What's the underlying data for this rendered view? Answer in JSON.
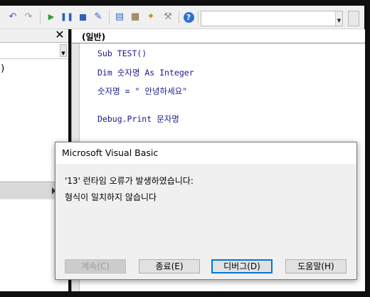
{
  "toolbar": {
    "icons": [
      "undo-icon",
      "redo-icon",
      "run-icon",
      "pause-icon",
      "stop-icon",
      "design-mode-icon",
      "project-explorer-icon",
      "properties-icon",
      "object-browser-icon",
      "toolbox-icon",
      "help-icon"
    ],
    "accent_run": "#2e9b3a",
    "accent_blue": "#2e5fbf"
  },
  "left_panel": {
    "close_label": "✕",
    "paren_text": ")"
  },
  "code_window": {
    "procedure_dropdown": "(일반)",
    "lines": [
      "Sub TEST()",
      "Dim 숫자명 As Integer",
      "숫자명 = \" 안녕하세요\"",
      "",
      "Debug.Print 문자명"
    ]
  },
  "dialog": {
    "title": "Microsoft Visual Basic",
    "message_line1": "'13' 런타임 오류가 발생하였습니다:",
    "message_line2": "형식이 일치하지 않습니다",
    "buttons": {
      "continue": "계속(C)",
      "end": "종료(E)",
      "debug": "디버그(D)",
      "help": "도움말(H)"
    }
  }
}
